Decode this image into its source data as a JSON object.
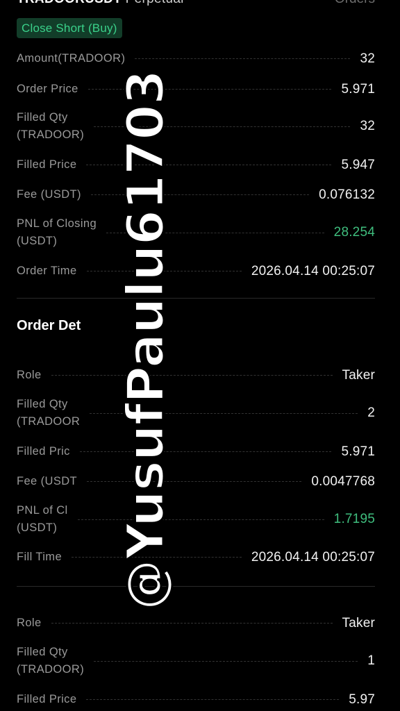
{
  "header": {
    "symbol": "TRADOORUSDT",
    "contract_type": "Perpetual",
    "orders_link": "Orders"
  },
  "badge": "Close Short (Buy)",
  "summary": [
    {
      "label": "Amount(TRADOOR)",
      "value": "32",
      "highlight": false
    },
    {
      "label": "Order Price",
      "value": "5.971",
      "highlight": false
    },
    {
      "label": "Filled Qty\n(TRADOOR)",
      "value": "32",
      "highlight": false
    },
    {
      "label": "Filled Price",
      "value": "5.947",
      "highlight": false
    },
    {
      "label": "Fee (USDT)",
      "value": "0.076132",
      "highlight": false
    },
    {
      "label": "PNL of Closing\n(USDT)",
      "value": "28.254",
      "highlight": true
    },
    {
      "label": "Order Time",
      "value": "2026.04.14 00:25:07",
      "highlight": false
    }
  ],
  "section_title": "Order Det",
  "fill1": [
    {
      "label": "Role",
      "value": "Taker",
      "highlight": false
    },
    {
      "label": "Filled Qty\n(TRADOOR",
      "value": "2",
      "highlight": false
    },
    {
      "label": "Filled Pric",
      "value": "5.971",
      "highlight": false
    },
    {
      "label": "Fee (USDT",
      "value": "0.0047768",
      "highlight": false
    },
    {
      "label": "PNL of Cl\n(USDT)",
      "value": "1.7195",
      "highlight": true
    },
    {
      "label": "Fill Time",
      "value": "2026.04.14 00:25:07",
      "highlight": false
    }
  ],
  "fill2": [
    {
      "label": "Role",
      "value": "Taker",
      "highlight": false
    },
    {
      "label": "Filled Qty\n(TRADOOR)",
      "value": "1",
      "highlight": false
    },
    {
      "label": "Filled Price",
      "value": "5.97",
      "highlight": false
    }
  ],
  "watermark": "@YusufPaulu61703",
  "colors": {
    "background": "#000000",
    "positive": "#3fbe7e",
    "badge_bg": "#123d29",
    "badge_text": "#3ad18a"
  }
}
